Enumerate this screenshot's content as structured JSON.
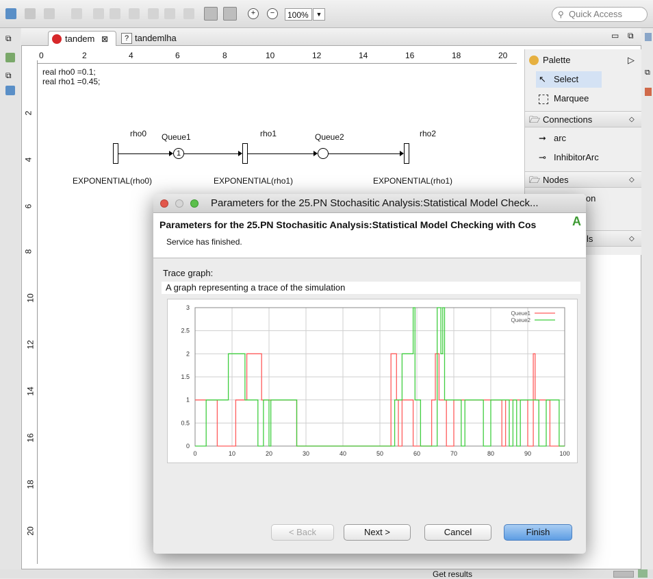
{
  "toolbar": {
    "zoom": "100%",
    "quick_access_placeholder": "Quick Access"
  },
  "editor": {
    "tabs": [
      {
        "label": "tandem",
        "close": "⊠"
      },
      {
        "label": "tandemlha"
      }
    ],
    "ruler_h": [
      "0",
      "2",
      "4",
      "6",
      "8",
      "10",
      "12",
      "14",
      "16",
      "18",
      "20"
    ],
    "ruler_v": [
      "2",
      "4",
      "6",
      "8",
      "10",
      "12",
      "14",
      "16",
      "18",
      "20"
    ],
    "code_lines": [
      "real rho0 =0.1;",
      "real rho1 =0.45;"
    ],
    "net": {
      "transition_labels": [
        "rho0",
        "rho1",
        "rho2"
      ],
      "place_labels": [
        "Queue1",
        "Queue2"
      ],
      "place_token": "1",
      "distributions": [
        "EXPONENTIAL(rho0)",
        "EXPONENTIAL(rho1)",
        "EXPONENTIAL(rho1)"
      ]
    }
  },
  "palette": {
    "title": "Palette",
    "tools": [
      "Select",
      "Marquee"
    ],
    "connections_label": "Connections",
    "connections": [
      "arc",
      "InhibitorArc"
    ],
    "nodes_label": "Nodes",
    "partial_item_1": "ion",
    "partial_item_2": "ls"
  },
  "status": {
    "text": "Get results"
  },
  "dialog": {
    "window_title": "Parameters for the 25.PN Stochasitic Analysis:Statistical Model Check...",
    "header_title": "Parameters for the 25.PN Stochasitic Analysis:Statistical Model Checking with Cos",
    "header_message": "Service has finished.",
    "field_label": "Trace graph:",
    "field_description": "A graph representing a trace of the simulation",
    "buttons": {
      "back": "< Back",
      "next": "Next >",
      "cancel": "Cancel",
      "finish": "Finish"
    }
  },
  "chart_data": {
    "type": "line",
    "step": true,
    "xlim": [
      0,
      100
    ],
    "ylim": [
      0,
      3
    ],
    "x_ticks": [
      "0",
      "10",
      "20",
      "30",
      "40",
      "50",
      "60",
      "70",
      "80",
      "90",
      "100"
    ],
    "y_ticks": [
      "0",
      "0.5",
      "1",
      "1.5",
      "2",
      "2.5",
      "3"
    ],
    "grid": true,
    "legend_position": "top-right",
    "series": [
      {
        "name": "Queue1",
        "color": "#ff5c5c",
        "points": [
          [
            0,
            1
          ],
          [
            6,
            1
          ],
          [
            6,
            0
          ],
          [
            11,
            0
          ],
          [
            11,
            1
          ],
          [
            14,
            1
          ],
          [
            14,
            2
          ],
          [
            18,
            2
          ],
          [
            18,
            1
          ],
          [
            21,
            1
          ],
          [
            21,
            1
          ],
          [
            27.5,
            1
          ],
          [
            27.5,
            0
          ],
          [
            53,
            0
          ],
          [
            53,
            2
          ],
          [
            54.5,
            2
          ],
          [
            54.5,
            1
          ],
          [
            55,
            1
          ],
          [
            55,
            0
          ],
          [
            56,
            0
          ],
          [
            56,
            1
          ],
          [
            59,
            1
          ],
          [
            59,
            0
          ],
          [
            64,
            0
          ],
          [
            64,
            1
          ],
          [
            65,
            1
          ],
          [
            65,
            2
          ],
          [
            66,
            2
          ],
          [
            66,
            1
          ],
          [
            68,
            1
          ],
          [
            68,
            0
          ],
          [
            70,
            0
          ],
          [
            70,
            1
          ],
          [
            83,
            1
          ],
          [
            83,
            0
          ],
          [
            84,
            0
          ],
          [
            84,
            1
          ],
          [
            90,
            1
          ],
          [
            90,
            0
          ],
          [
            91.5,
            0
          ],
          [
            91.5,
            2
          ],
          [
            92,
            2
          ],
          [
            92,
            1
          ],
          [
            96,
            1
          ],
          [
            96,
            0
          ],
          [
            100,
            0
          ]
        ]
      },
      {
        "name": "Queue2",
        "color": "#3fce3f",
        "points": [
          [
            0,
            0
          ],
          [
            3,
            0
          ],
          [
            3,
            1
          ],
          [
            9,
            1
          ],
          [
            9,
            2
          ],
          [
            13.5,
            2
          ],
          [
            13.5,
            1
          ],
          [
            17,
            1
          ],
          [
            17,
            0
          ],
          [
            18.5,
            0
          ],
          [
            18.5,
            1
          ],
          [
            20,
            1
          ],
          [
            20,
            0
          ],
          [
            20.5,
            0
          ],
          [
            20.5,
            1
          ],
          [
            27.5,
            1
          ],
          [
            27.5,
            0
          ],
          [
            54,
            0
          ],
          [
            54,
            1
          ],
          [
            56,
            1
          ],
          [
            56,
            2
          ],
          [
            59,
            2
          ],
          [
            59,
            3
          ],
          [
            59.5,
            3
          ],
          [
            59.5,
            1
          ],
          [
            61,
            1
          ],
          [
            61,
            0
          ],
          [
            65.5,
            0
          ],
          [
            65.5,
            3
          ],
          [
            66.5,
            3
          ],
          [
            66.5,
            2
          ],
          [
            67,
            2
          ],
          [
            67,
            3
          ],
          [
            67.5,
            3
          ],
          [
            67.5,
            1
          ],
          [
            72,
            1
          ],
          [
            72,
            0
          ],
          [
            73,
            0
          ],
          [
            73,
            1
          ],
          [
            78,
            1
          ],
          [
            78,
            0
          ],
          [
            80,
            0
          ],
          [
            80,
            1
          ],
          [
            85,
            1
          ],
          [
            85,
            0
          ],
          [
            86,
            0
          ],
          [
            86,
            1
          ],
          [
            87,
            1
          ],
          [
            87,
            0
          ],
          [
            88,
            0
          ],
          [
            88,
            1
          ],
          [
            93,
            1
          ],
          [
            93,
            0
          ],
          [
            95,
            0
          ],
          [
            95,
            1
          ],
          [
            98.5,
            1
          ],
          [
            98.5,
            0
          ],
          [
            100,
            0
          ]
        ]
      }
    ]
  }
}
